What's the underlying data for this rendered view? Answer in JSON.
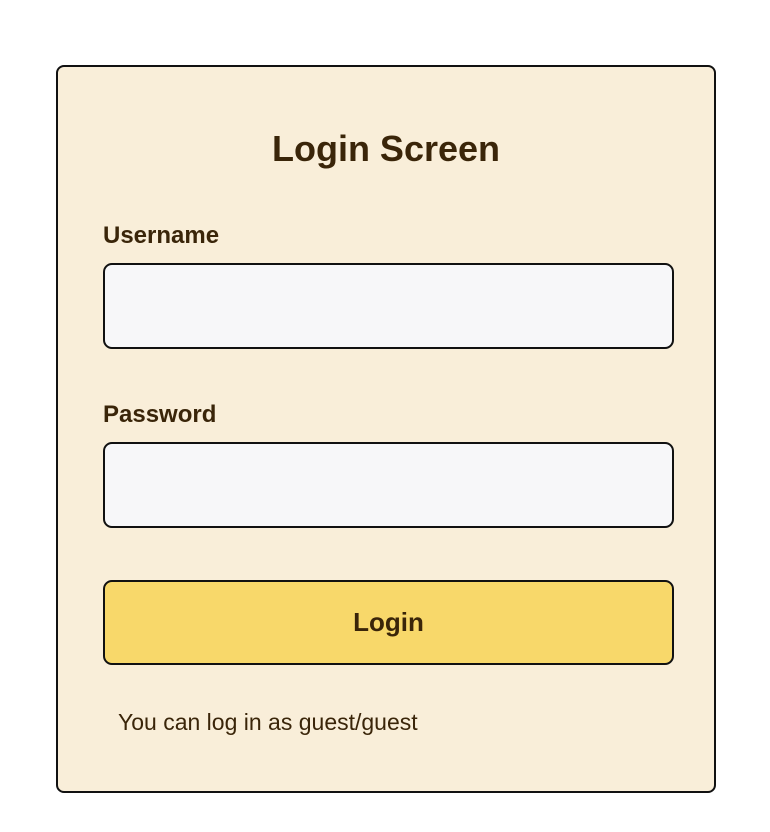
{
  "login_form": {
    "title": "Login Screen",
    "username_label": "Username",
    "username_value": "",
    "password_label": "Password",
    "password_value": "",
    "login_button_label": "Login",
    "hint_text": "You can log in as guest/guest"
  },
  "colors": {
    "card_background": "#f9eed9",
    "button_background": "#f8d86a",
    "input_background": "#f7f7f9",
    "text": "#3a2509",
    "border": "#111111"
  }
}
